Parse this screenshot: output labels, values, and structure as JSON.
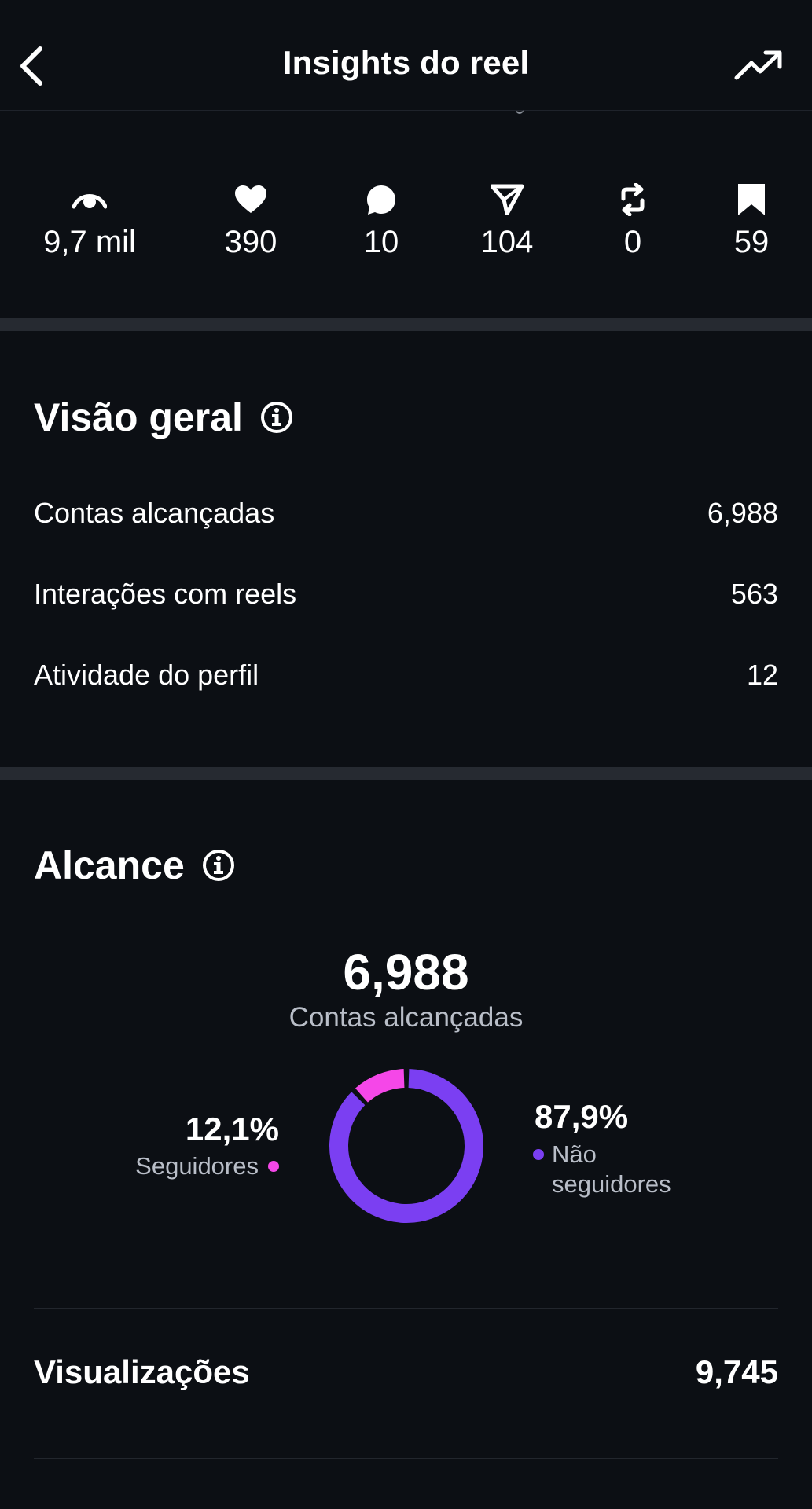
{
  "header": {
    "title": "Insights do reel"
  },
  "metrics": [
    {
      "icon": "eye-icon",
      "value": "9,7 mil"
    },
    {
      "icon": "heart-icon",
      "value": "390"
    },
    {
      "icon": "comment-icon",
      "value": "10"
    },
    {
      "icon": "share-icon",
      "value": "104"
    },
    {
      "icon": "repost-icon",
      "value": "0"
    },
    {
      "icon": "bookmark-icon",
      "value": "59"
    }
  ],
  "overview": {
    "title": "Visão geral",
    "rows": [
      {
        "label": "Contas alcançadas",
        "value": "6,988"
      },
      {
        "label": "Interações com reels",
        "value": "563"
      },
      {
        "label": "Atividade do perfil",
        "value": "12"
      }
    ]
  },
  "reach": {
    "title": "Alcance",
    "total": "6,988",
    "total_label": "Contas alcançadas",
    "followers": {
      "pct_label": "12,1%",
      "label": "Seguidores",
      "fraction": 0.121,
      "color": "#f547e8"
    },
    "non_followers": {
      "pct_label": "87,9%",
      "label_line1": "Não",
      "label_line2": "seguidores",
      "fraction": 0.879,
      "color": "#7b3ff2"
    }
  },
  "views": {
    "label": "Visualizações",
    "value": "9,745"
  }
}
